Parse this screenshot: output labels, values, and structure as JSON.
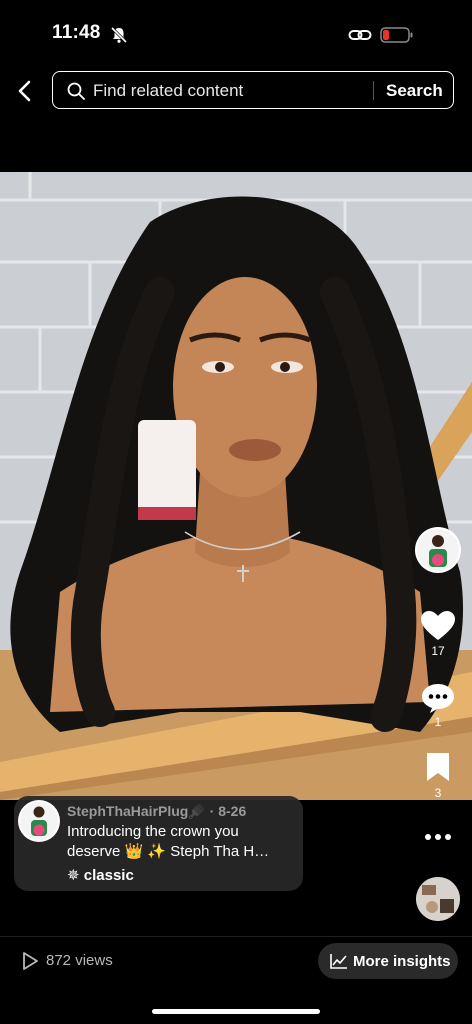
{
  "status_bar": {
    "time": "11:48",
    "icons": [
      "bell-slash-icon",
      "link-icon",
      "battery-low-icon"
    ],
    "battery_color": "#e5332a"
  },
  "header": {
    "back_icon": "chevron-left-icon",
    "search_placeholder": "Find related content",
    "search_button_label": "Search"
  },
  "video": {
    "description_icon_set": []
  },
  "actions": {
    "like_count": "17",
    "comment_count": "1",
    "save_count": "3"
  },
  "caption": {
    "author": "StephThaHairPlug🪮",
    "date": "· 8-26",
    "text": "Introducing the crown you deserve 👑 ✨  Steph Tha H…",
    "music": "classic",
    "music_icon": "sparkle-icon"
  },
  "footer": {
    "views_label": "872 views",
    "insights_label": "More insights"
  },
  "colors": {
    "background": "#000000",
    "pill": "#2a2a2a",
    "muted_text": "#9a9a9a"
  }
}
